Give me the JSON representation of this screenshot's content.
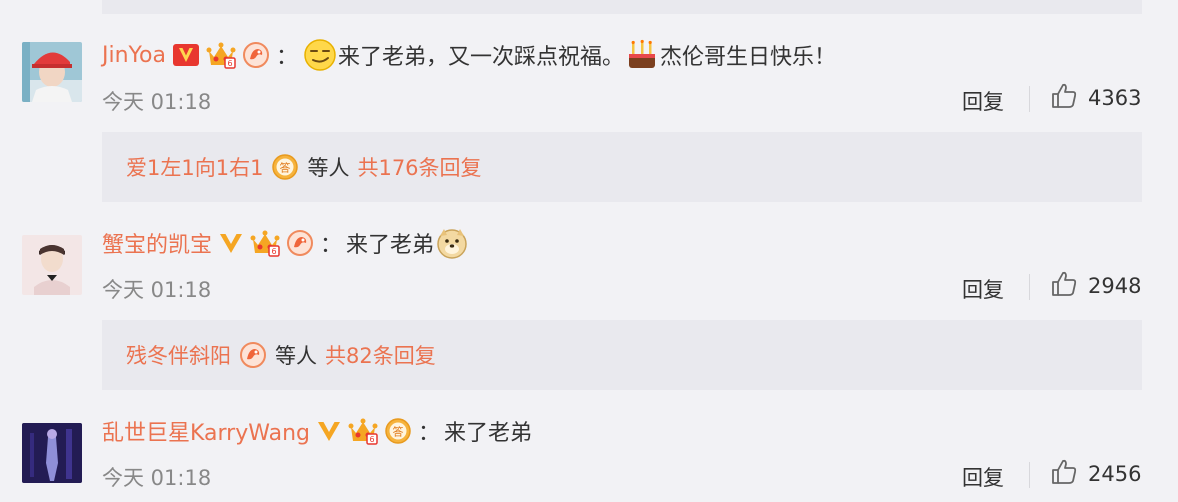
{
  "comments": [
    {
      "username": "JinYoa",
      "colon": "：",
      "text_1": "来了老弟，又一次踩点祝福。",
      "text_2": "杰伦哥生日快乐！",
      "time": "今天 01:18",
      "reply_label": "回复",
      "likes": "4363",
      "reply_summary": {
        "user": "爱1左1向1右1",
        "middle": "等人",
        "total": "共176条回复"
      }
    },
    {
      "username": "蟹宝的凯宝",
      "colon": "：",
      "text_1": "来了老弟",
      "time": "今天 01:18",
      "reply_label": "回复",
      "likes": "2948",
      "reply_summary": {
        "user": "残冬伴斜阳",
        "middle": "等人",
        "total": "共82条回复"
      }
    },
    {
      "username": "乱世巨星KarryWang",
      "colon": "：",
      "text_1": "来了老弟",
      "time": "今天 01:18",
      "reply_label": "回复",
      "likes": "2456"
    }
  ],
  "icons": {
    "verified": "verified-v-icon",
    "member": "member-crown-icon",
    "fan": "fan-badge-icon",
    "answer": "answer-badge-icon",
    "like": "thumbs-up-icon",
    "smirk": "smirk-emoji-icon",
    "cake": "birthday-cake-emoji-icon",
    "doge": "doge-emoji-icon"
  },
  "colors": {
    "accent": "#eb7350",
    "verified_red": "#e8372f",
    "verified_gold": "#f5a623",
    "background": "#f2f2f5",
    "reply_box": "#e9e9ee",
    "meta_text": "#888888"
  }
}
